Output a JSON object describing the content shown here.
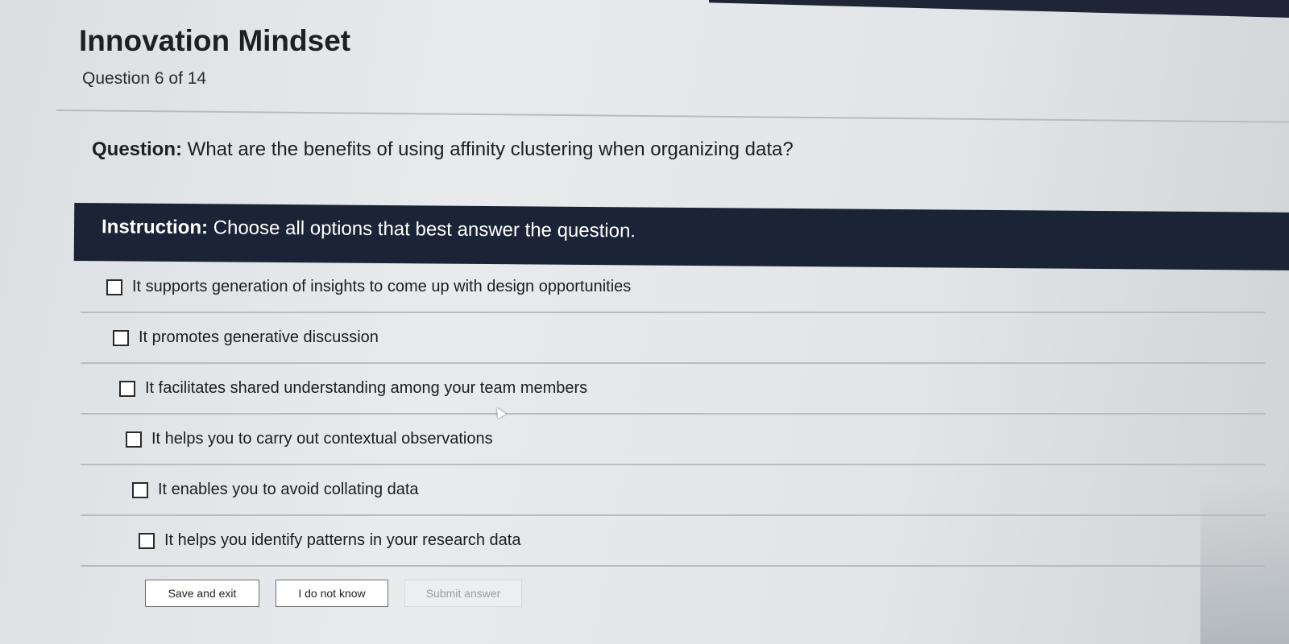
{
  "header": {
    "course_title": "Innovation Mindset",
    "progress": "Question 6 of 14"
  },
  "question": {
    "label": "Question:",
    "text": " What are the benefits of using affinity clustering when organizing data?"
  },
  "instruction": {
    "label": "Instruction:",
    "text": " Choose all options that best answer the question."
  },
  "options": [
    "It supports generation of insights to come up with design opportunities",
    "It promotes generative discussion",
    "It facilitates shared understanding among your team members",
    "It helps you to carry out contextual observations",
    "It enables you to avoid collating data",
    "It helps you identify patterns in your research data"
  ],
  "buttons": {
    "save_exit": "Save and exit",
    "dont_know": "I do not know",
    "submit": "Submit answer"
  },
  "colors": {
    "instruction_bar": "#1b2336",
    "accent_dark": "#1d2537"
  }
}
